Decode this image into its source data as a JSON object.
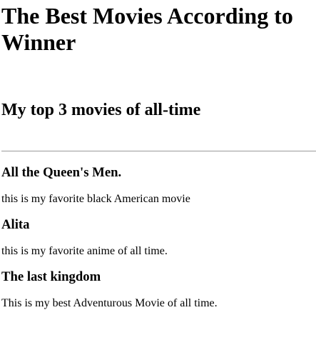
{
  "page": {
    "title": "The Best Movies According to Winner",
    "subtitle": "My top 3 movies of all-time"
  },
  "movies": [
    {
      "title": "All the Queen's Men.",
      "description": "this is my favorite black American movie"
    },
    {
      "title": "Alita",
      "description": "this is my favorite anime of all time."
    },
    {
      "title": "The last kingdom",
      "description": "This is my best Adventurous Movie of all time."
    }
  ]
}
